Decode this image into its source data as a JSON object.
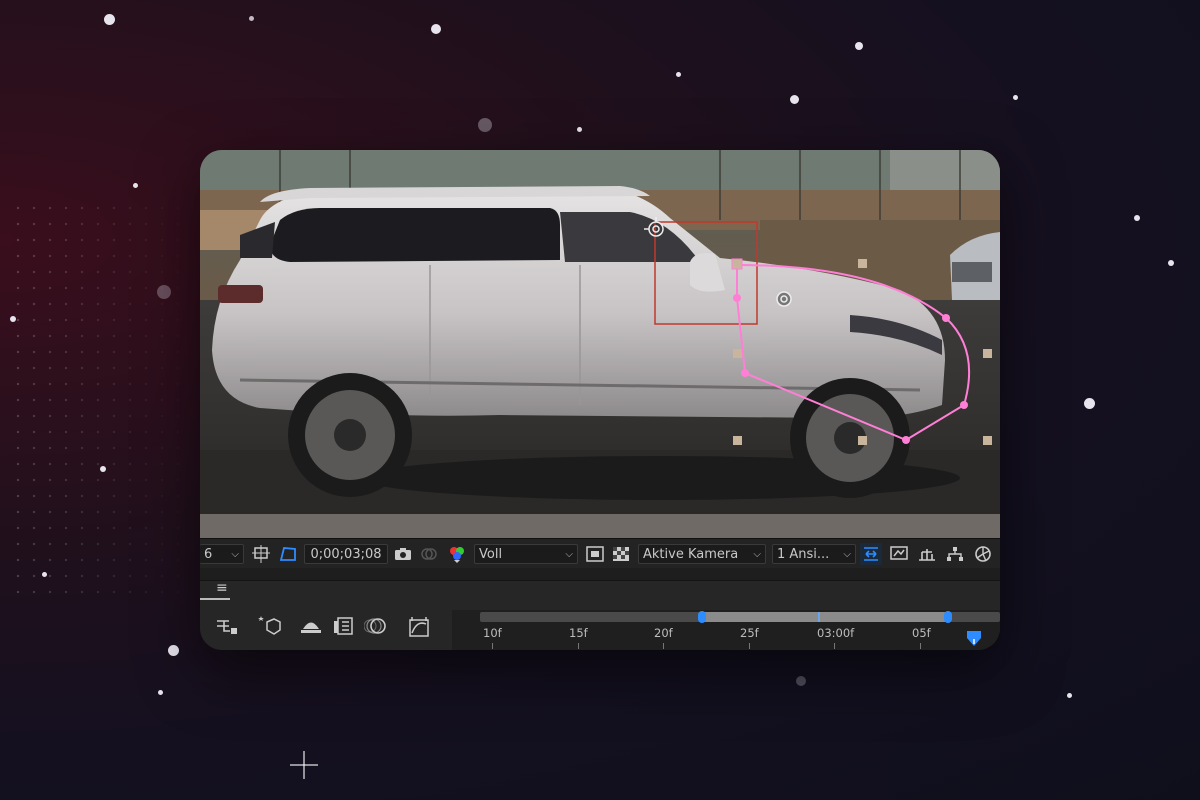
{
  "viewer_toolbar": {
    "zoom_fragment": "6",
    "timecode": "0;00;03;08",
    "resolution": "Voll",
    "camera": "Aktive Kamera",
    "views": "1 Ansi..."
  },
  "timeline": {
    "panel_menu_icon": "≡",
    "ruler_labels": [
      "10f",
      "15f",
      "20f",
      "25f",
      "03:00f",
      "05f"
    ]
  },
  "colors": {
    "mask_path": "#ff7fd6",
    "tracker_box": "#c0392b",
    "accent_blue": "#2d8cff",
    "background": "#141020"
  }
}
